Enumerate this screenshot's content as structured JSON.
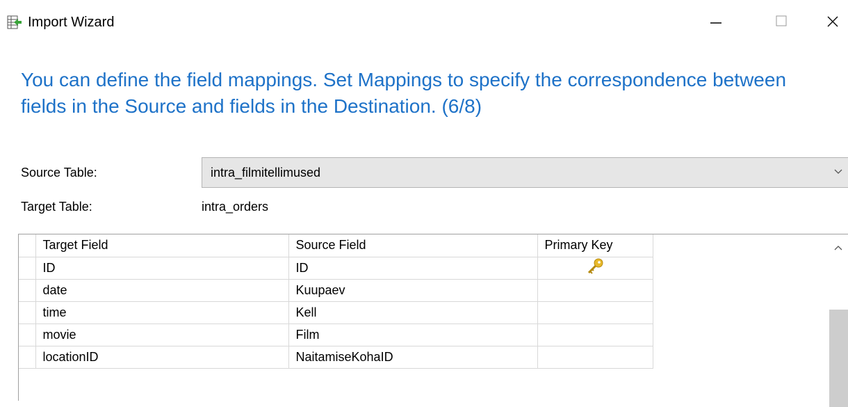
{
  "window": {
    "title": "Import Wizard",
    "icon": "import-table-icon",
    "controls": [
      "minimize-icon",
      "maximize-icon",
      "close-icon"
    ]
  },
  "heading": "You can define the field mappings. Set Mappings to specify the correspondence between fields in the Source and fields in the Destination. (6/8)",
  "source_table": {
    "label": "Source Table:",
    "value": "intra_filmitellimused"
  },
  "target_table": {
    "label": "Target Table:",
    "value": "intra_orders"
  },
  "grid": {
    "columns": [
      "Target Field",
      "Source Field",
      "Primary Key"
    ],
    "rows": [
      {
        "target": "ID",
        "source": "ID",
        "primary_key": true
      },
      {
        "target": "date",
        "source": "Kuupaev",
        "primary_key": false
      },
      {
        "target": "time",
        "source": "Kell",
        "primary_key": false
      },
      {
        "target": "movie",
        "source": "Film",
        "primary_key": false
      },
      {
        "target": "locationID",
        "source": "NaitamiseKohaID",
        "primary_key": false
      }
    ]
  },
  "colors": {
    "heading": "#1e72c8",
    "key_icon": "#e8b92a"
  }
}
